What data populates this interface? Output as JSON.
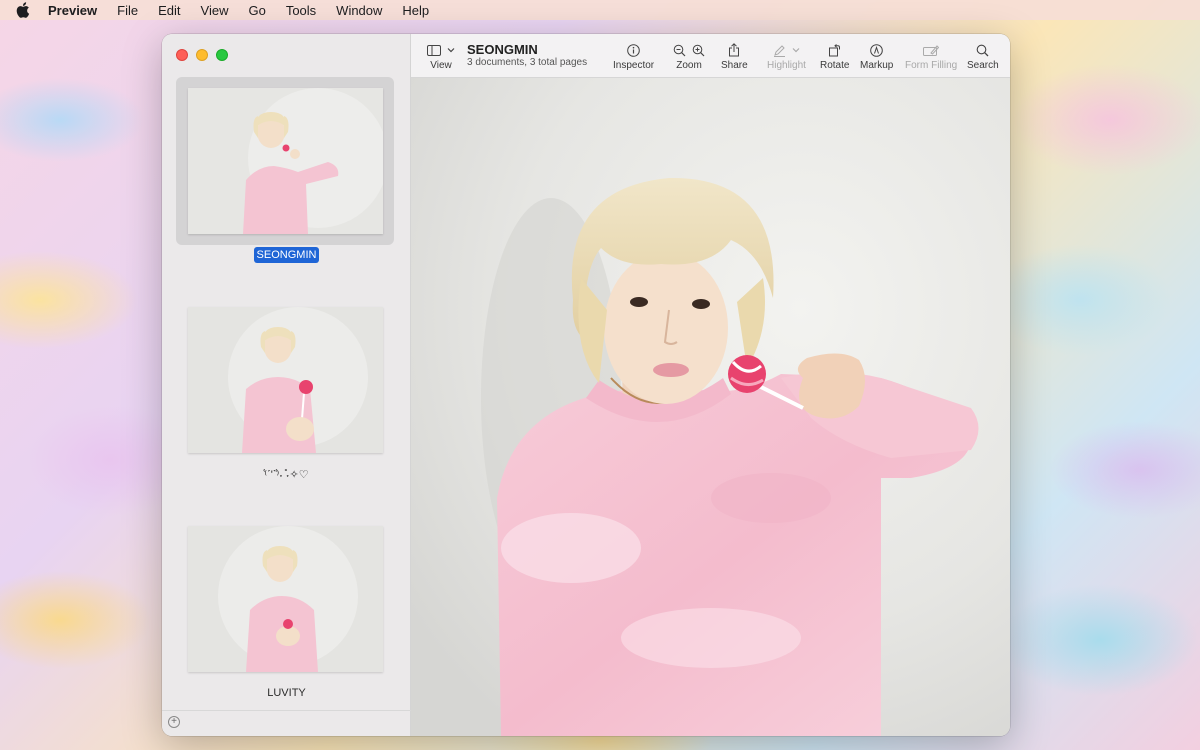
{
  "menubar": {
    "app_name": "Preview",
    "items": [
      "File",
      "Edit",
      "View",
      "Go",
      "Tools",
      "Window",
      "Help"
    ]
  },
  "document": {
    "title": "SEONGMIN",
    "subtitle": "3 documents, 3 total pages"
  },
  "toolbar": {
    "view": "View",
    "inspector": "Inspector",
    "zoom": "Zoom",
    "share": "Share",
    "highlight": "Highlight",
    "rotate": "Rotate",
    "markup": "Markup",
    "form_filling": "Form Filling",
    "search": "Search"
  },
  "sidebar": {
    "thumbnails": [
      {
        "label": "SEONGMIN",
        "selected": true
      },
      {
        "label": "⁽͑ˊ'ˋ⁾͑˖ ̊˖✧♡",
        "selected": false
      },
      {
        "label": "LUVITY",
        "selected": false
      }
    ],
    "add_label": "+"
  },
  "colors": {
    "sweater": "#f6c5d3",
    "hair": "#eee0bc",
    "selection": "#1f65d6",
    "lollipop": "#e8436e"
  }
}
